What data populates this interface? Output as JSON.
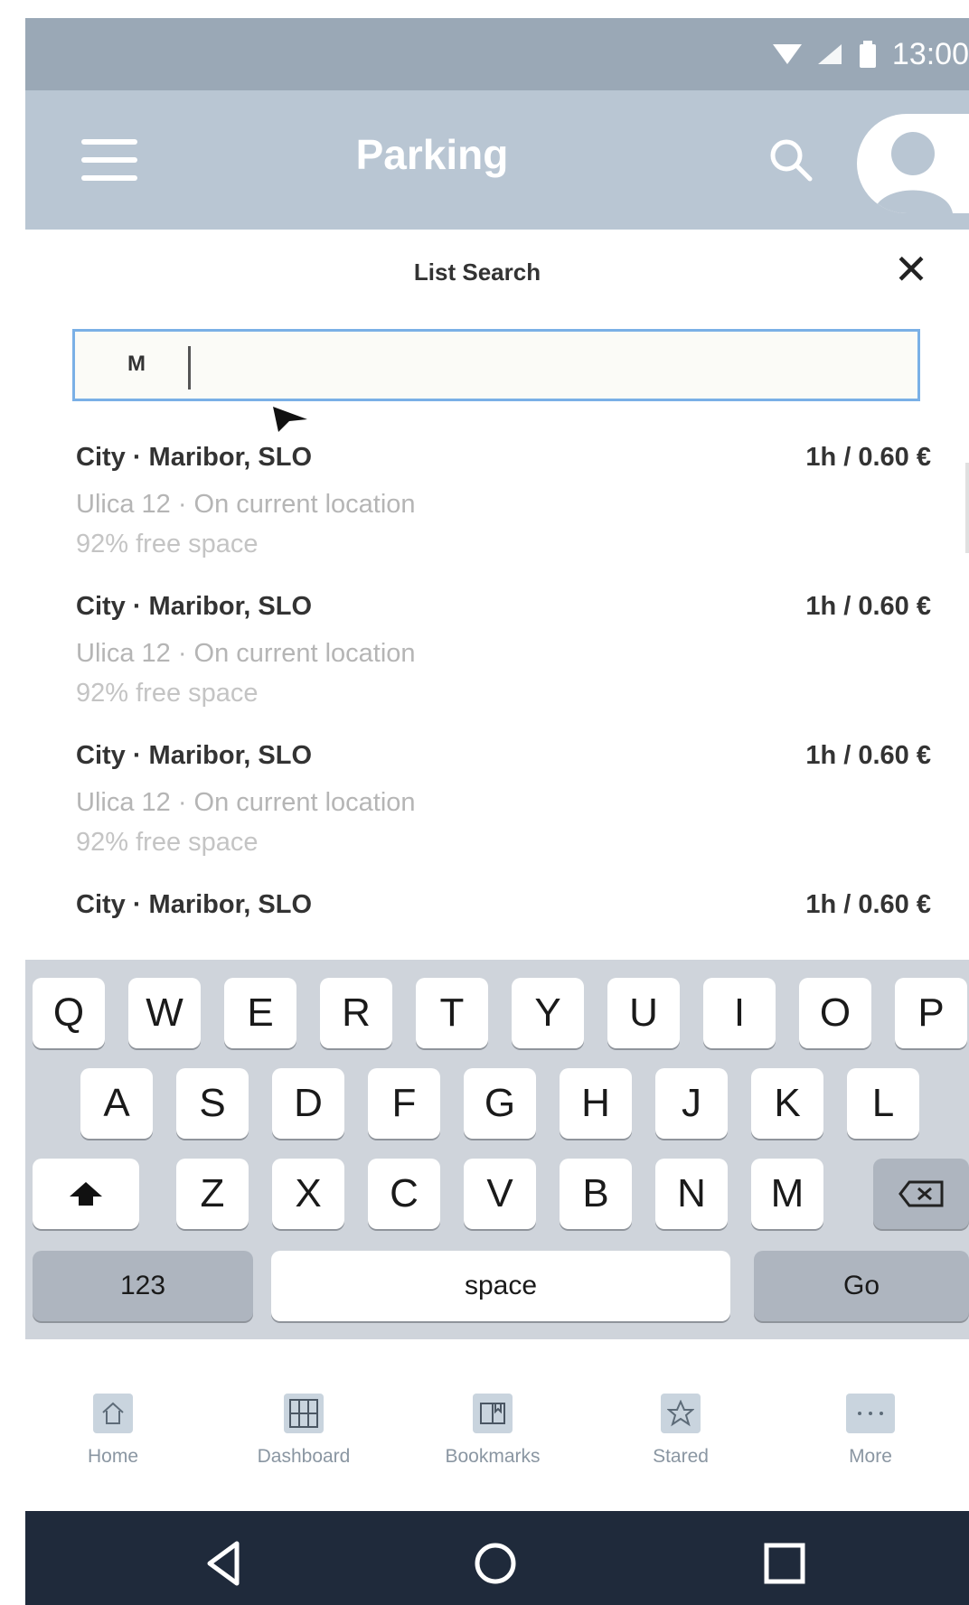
{
  "status_bar": {
    "time": "13:00"
  },
  "app_bar": {
    "title": "Parking"
  },
  "search_panel": {
    "title": "List Search",
    "close_label": "✕",
    "input_value": "M"
  },
  "results": [
    {
      "title": "City · Maribor, SLO",
      "price": "1h / 0.60 €",
      "subtitle": "Ulica 12 · On current location",
      "free_space": "92% free space"
    },
    {
      "title": "City · Maribor, SLO",
      "price": "1h / 0.60 €",
      "subtitle": "Ulica 12 · On current location",
      "free_space": "92% free space"
    },
    {
      "title": "City · Maribor, SLO",
      "price": "1h / 0.60 €",
      "subtitle": "Ulica 12 · On current location",
      "free_space": "92% free space"
    },
    {
      "title": "City · Maribor, SLO",
      "price": "1h / 0.60 €"
    }
  ],
  "keyboard": {
    "row1": [
      "Q",
      "W",
      "E",
      "R",
      "T",
      "Y",
      "U",
      "I",
      "O",
      "P"
    ],
    "row2": [
      "A",
      "S",
      "D",
      "F",
      "G",
      "H",
      "J",
      "K",
      "L"
    ],
    "row3": [
      "Z",
      "X",
      "C",
      "V",
      "B",
      "N",
      "M"
    ],
    "numbers_label": "123",
    "space_label": "space",
    "go_label": "Go"
  },
  "bottom_nav": [
    {
      "label": "Home",
      "icon": "home-icon"
    },
    {
      "label": "Dashboard",
      "icon": "grid-icon"
    },
    {
      "label": "Bookmarks",
      "icon": "book-icon"
    },
    {
      "label": "Stared",
      "icon": "star-icon"
    },
    {
      "label": "More",
      "icon": "more-icon"
    }
  ],
  "colors": {
    "status_bar": "#9aa8b6",
    "app_bar": "#b9c6d3",
    "accent_border": "#7ab0e6",
    "android_nav": "#1f2a3b"
  }
}
